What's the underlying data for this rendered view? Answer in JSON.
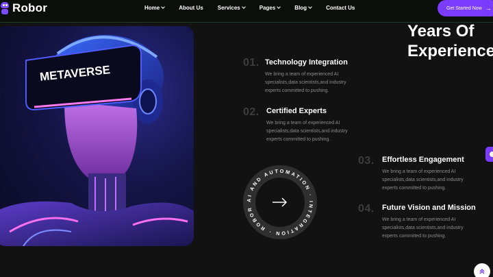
{
  "brand": {
    "name": "Robor"
  },
  "nav": {
    "items": [
      {
        "label": "Home",
        "dropdown": true
      },
      {
        "label": "About Us",
        "dropdown": false
      },
      {
        "label": "Services",
        "dropdown": true
      },
      {
        "label": "Pages",
        "dropdown": true
      },
      {
        "label": "Blog",
        "dropdown": true
      },
      {
        "label": "Contact Us",
        "dropdown": false
      }
    ],
    "cta_label": "Get Started Now"
  },
  "hero": {
    "visor_text": "METAVERSE"
  },
  "section": {
    "title_line1": "Years Of",
    "title_line2": "Experience"
  },
  "features": [
    {
      "number": "01.",
      "title": "Technology Integration",
      "desc": "We bring a team of experienced AI specialists,data scientists,and industry experts committed to pushing."
    },
    {
      "number": "02.",
      "title": "Certified Experts",
      "desc": "We bring a team of experienced AI specialists,data scientists,and industry experts committed to pushing."
    },
    {
      "number": "03.",
      "title": "Effortless Engagement",
      "desc": "We bring a team of experienced AI specialists,data scientists,and industry experts committed to pushing."
    },
    {
      "number": "04.",
      "title": "Future Vision and Mission",
      "desc": "We bring a team of experienced AI specialists,data scientists,and industry experts committed to pushing."
    }
  ],
  "badge": {
    "ring_text": "AI AND AUTOMATION · INTEGRATION · ROBOR · "
  },
  "colors": {
    "accent": "#7b3cff",
    "background": "#121212",
    "muted_text": "#8c8c8c"
  },
  "icons": {
    "cta": "arrow-right-icon",
    "badge": "arrow-right-icon",
    "to_top": "chevrons-up-icon"
  }
}
